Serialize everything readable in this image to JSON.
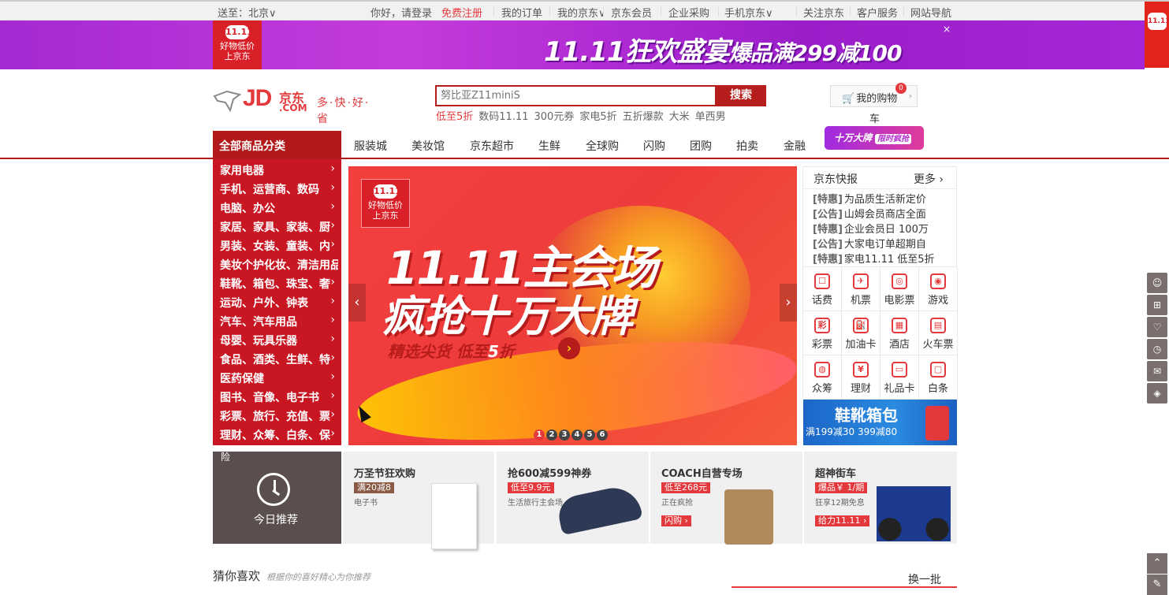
{
  "topbar": {
    "location": "送至：北京∨",
    "greeting": "你好，请登录",
    "register": "免费注册",
    "links": [
      "我的订单",
      "我的京东∨",
      "京东会员",
      "企业采购",
      "手机京东∨",
      "关注京东∨",
      "客户服务∨",
      "网站导航∨"
    ]
  },
  "banner": {
    "badge_top": "11.11",
    "badge_line1": "好物低价",
    "badge_line2": "上京东",
    "headline": "11.11狂欢盛宴",
    "headline_sub": "爆品满299减100",
    "close": "×"
  },
  "header": {
    "logo_text": "JD",
    "logo_cn": "京东",
    "logo_com": ".COM",
    "slogan": "多·快·好·省",
    "search_placeholder": "努比亚Z11miniS",
    "search_button": "搜索",
    "hotwords": [
      "低至5折",
      "数码11.11",
      "300元券",
      "家电5折",
      "五折爆款",
      "大米",
      "单西男"
    ],
    "cart_label": "我的购物",
    "cart_label_wrap": "车",
    "cart_count": "0"
  },
  "nav": {
    "category_title": "全部商品分类",
    "items": [
      "服装城",
      "美妆馆",
      "京东超市",
      "生鲜",
      "全球购",
      "闪购",
      "团购",
      "拍卖",
      "金融"
    ],
    "promo": "十万大牌",
    "promo_sub": "限时疯抢"
  },
  "categories": [
    "家用电器",
    "手机、运营商、数码",
    "电脑、办公",
    "家居、家具、家装、厨",
    "男装、女装、童装、内",
    "美妆个护化妆、清洁用品、",
    "鞋靴、箱包、珠宝、奢",
    "运动、户外、钟表",
    "汽车、汽车用品",
    "母婴、玩具乐器",
    "食品、酒类、生鲜、特",
    "医药保健",
    "图书、音像、电子书",
    "彩票、旅行、充值、票",
    "理财、众筹、白条、保"
  ],
  "slider": {
    "badge_top": "11.11",
    "badge_line1": "好物低价",
    "badge_line2": "上京东",
    "title1": "11.11主会场",
    "title2": "疯抢十万大牌",
    "tagline": "精选尖货 低至",
    "tagline_num": "5",
    "tagline_end": "折",
    "dots": [
      "1",
      "2",
      "3",
      "4",
      "5",
      "6"
    ],
    "active_dot": 0
  },
  "news": {
    "title": "京东快报",
    "more": "更多 ›",
    "items": [
      {
        "tag": "[特惠]",
        "text": "为品质生活新定价"
      },
      {
        "tag": "[公告]",
        "text": "山姆会员商店全面"
      },
      {
        "tag": "[特惠]",
        "text": "企业会员日 100万"
      },
      {
        "tag": "[公告]",
        "text": "大家电订单超期自"
      },
      {
        "tag": "[特惠]",
        "text": "家电11.11 低至5折"
      }
    ]
  },
  "services": [
    {
      "label": "话费",
      "icon": "phone-icon",
      "glyph": "☐"
    },
    {
      "label": "机票",
      "icon": "plane-icon",
      "glyph": "✈"
    },
    {
      "label": "电影票",
      "icon": "film-icon",
      "glyph": "◎"
    },
    {
      "label": "游戏",
      "icon": "gamepad-icon",
      "glyph": "◉"
    },
    {
      "label": "彩票",
      "icon": "lottery-icon",
      "glyph": "彩"
    },
    {
      "label": "加油卡",
      "icon": "fuel-icon",
      "glyph": "⛽"
    },
    {
      "label": "酒店",
      "icon": "hotel-icon",
      "glyph": "▦"
    },
    {
      "label": "火车票",
      "icon": "train-icon",
      "glyph": "▤"
    },
    {
      "label": "众筹",
      "icon": "crowdfund-icon",
      "glyph": "◍"
    },
    {
      "label": "理财",
      "icon": "finance-icon",
      "glyph": "¥"
    },
    {
      "label": "礼品卡",
      "icon": "giftcard-icon",
      "glyph": "▭"
    },
    {
      "label": "白条",
      "icon": "credit-icon",
      "glyph": "▢"
    }
  ],
  "shoe_ad": {
    "title": "鞋靴箱包",
    "sub": "满199减30 399减80"
  },
  "today": {
    "top": "险",
    "label": "今日推荐"
  },
  "promos": [
    {
      "title": "万圣节狂欢购",
      "tag": "满20减8",
      "sub": "电子书",
      "btn": ""
    },
    {
      "title": "抢600减599神券",
      "tag": "低至9.9元",
      "sub": "生活旅行主会场",
      "btn": ""
    },
    {
      "title": "COACH自营专场",
      "tag": "低至268元",
      "sub": "正在疯抢",
      "btn": "闪购 ›"
    },
    {
      "title": "超神街车",
      "tag": "爆品￥ 1/期",
      "sub": "狂享12期免息",
      "btn": "给力11.11 ›"
    }
  ],
  "guess": {
    "title": "猜你喜欢",
    "subtitle": "根据你的喜好精心为你推荐",
    "refresh": "换一批"
  },
  "colors": {
    "brand_red": "#e4393c",
    "nav_red": "#b1191a",
    "category_red": "#c81623",
    "banner_purple": "#a32ad1"
  }
}
